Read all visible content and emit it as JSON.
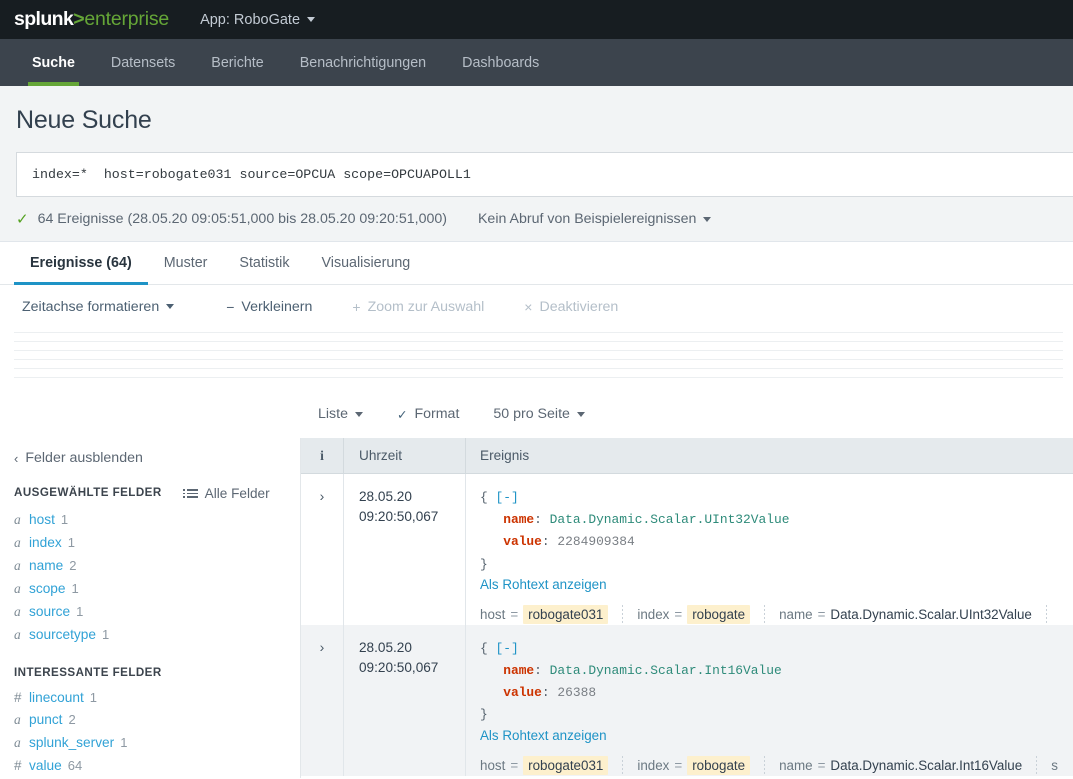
{
  "header": {
    "logo_splunk": "splunk",
    "logo_gt": ">",
    "logo_enterprise": "enterprise",
    "app_menu": "App: RoboGate"
  },
  "nav": {
    "items": [
      {
        "label": "Suche",
        "active": true
      },
      {
        "label": "Datensets",
        "active": false
      },
      {
        "label": "Berichte",
        "active": false
      },
      {
        "label": "Benachrichtigungen",
        "active": false
      },
      {
        "label": "Dashboards",
        "active": false
      }
    ]
  },
  "search": {
    "page_title": "Neue Suche",
    "query": "index=*  host=robogate031 source=OPCUA scope=OPCUAPOLL1",
    "results_text": "64 Ereignisse (28.05.20 09:05:51,000 bis 28.05.20 09:20:51,000)",
    "check_icon": "check-icon",
    "sample_menu": "Kein Abruf von Beispielereignissen"
  },
  "result_tabs": [
    {
      "label": "Ereignisse (64)",
      "active": true
    },
    {
      "label": "Muster",
      "active": false
    },
    {
      "label": "Statistik",
      "active": false
    },
    {
      "label": "Visualisierung",
      "active": false
    }
  ],
  "timeline_toolbar": {
    "format_label": "Zeitachse formatieren",
    "zoom_out_label": "Verkleinern",
    "zoom_out_sym": "−",
    "zoom_selection_label": "Zoom zur Auswahl",
    "zoom_selection_sym": "+",
    "deselect_label": "Deaktivieren",
    "deselect_sym": "×"
  },
  "list_controls": {
    "list_label": "Liste",
    "format_label": "Format",
    "format_icon": "pencil-icon",
    "per_page_label": "50 pro Seite"
  },
  "sidebar": {
    "hide_fields": "Felder ausblenden",
    "selected_heading": "AUSGEWÄHLTE FELDER",
    "all_fields": "Alle Felder",
    "all_fields_icon": "list-icon",
    "selected_fields": [
      {
        "type": "a",
        "name": "host",
        "count": "1"
      },
      {
        "type": "a",
        "name": "index",
        "count": "1"
      },
      {
        "type": "a",
        "name": "name",
        "count": "2"
      },
      {
        "type": "a",
        "name": "scope",
        "count": "1"
      },
      {
        "type": "a",
        "name": "source",
        "count": "1"
      },
      {
        "type": "a",
        "name": "sourcetype",
        "count": "1"
      }
    ],
    "interesting_heading": "INTERESSANTE FELDER",
    "interesting_fields": [
      {
        "type": "#",
        "name": "linecount",
        "count": "1"
      },
      {
        "type": "a",
        "name": "punct",
        "count": "2"
      },
      {
        "type": "a",
        "name": "splunk_server",
        "count": "1"
      },
      {
        "type": "#",
        "name": "value",
        "count": "64"
      }
    ]
  },
  "events_table": {
    "columns": {
      "info": "i",
      "time": "Uhrzeit",
      "event": "Ereignis"
    },
    "raw_link_label": "Als Rohtext anzeigen",
    "collapse_toggle": "[-]",
    "rows": [
      {
        "time_date": "28.05.20",
        "time_clock": "09:20:50,067",
        "json": {
          "open": "{",
          "key1": "name",
          "val1": "Data.Dynamic.Scalar.UInt32Value",
          "key2": "value",
          "val2": "2284909384",
          "close": "}"
        },
        "fields": [
          {
            "name": "host",
            "value": "robogate031",
            "highlight": true
          },
          {
            "name": "index",
            "value": "robogate",
            "highlight": true
          },
          {
            "name": "name",
            "value": "Data.Dynamic.Scalar.UInt32Value",
            "highlight": false
          }
        ]
      },
      {
        "time_date": "28.05.20",
        "time_clock": "09:20:50,067",
        "json": {
          "open": "{",
          "key1": "name",
          "val1": "Data.Dynamic.Scalar.Int16Value",
          "key2": "value",
          "val2": "26388",
          "close": "}"
        },
        "fields": [
          {
            "name": "host",
            "value": "robogate031",
            "highlight": true
          },
          {
            "name": "index",
            "value": "robogate",
            "highlight": true
          },
          {
            "name": "name",
            "value": "Data.Dynamic.Scalar.Int16Value",
            "highlight": false
          },
          {
            "name": "s",
            "value": "",
            "highlight": false
          }
        ]
      }
    ]
  },
  "colors": {
    "brand_green": "#65A637",
    "topbar": "#171D21",
    "navbar": "#3C444D",
    "tab_accent": "#1e93c6",
    "link": "#1e93c6",
    "json_key": "#cc3300",
    "json_string": "#2e8b7a",
    "highlight": "#fdf0cd"
  }
}
